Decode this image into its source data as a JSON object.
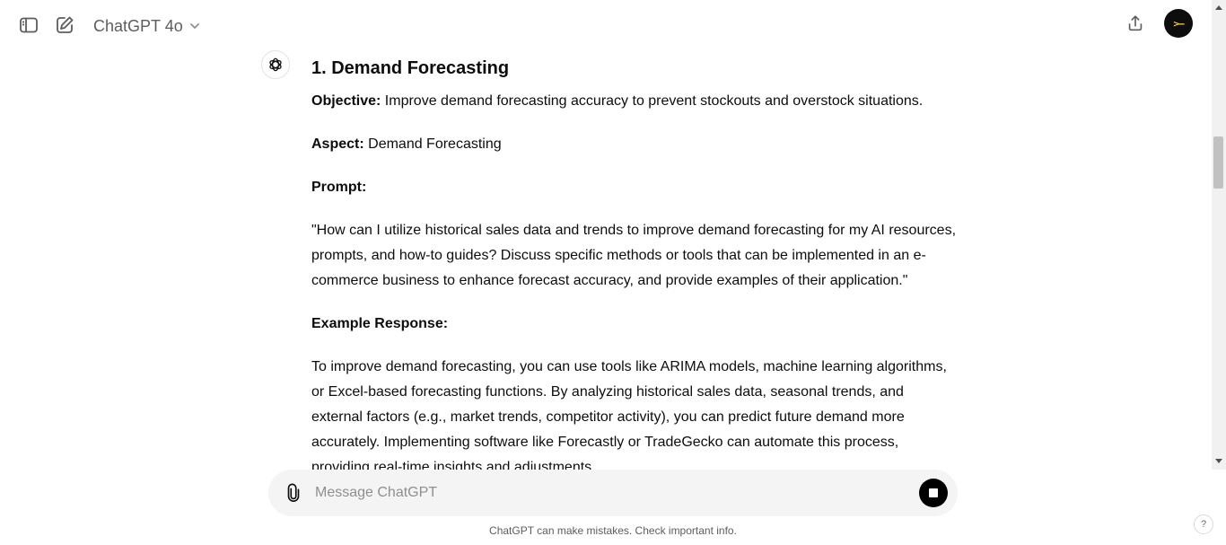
{
  "header": {
    "model_label": "ChatGPT 4o",
    "icons": {
      "sidebar": "sidebar-toggle-icon",
      "new_chat": "new-chat-icon",
      "dropdown": "chevron-down-icon",
      "share": "share-icon"
    },
    "avatar_text": ">–"
  },
  "message": {
    "heading": "1. Demand Forecasting",
    "objective_label": "Objective:",
    "objective_text": " Improve demand forecasting accuracy to prevent stockouts and overstock situations.",
    "aspect_label": "Aspect:",
    "aspect_text": " Demand Forecasting",
    "prompt_label": "Prompt:",
    "prompt_text": "\"How can I utilize historical sales data and trends to improve demand forecasting for my AI resources, prompts, and how-to guides? Discuss specific methods or tools that can be implemented in an e-commerce business to enhance forecast accuracy, and provide examples of their application.\"",
    "example_label": "Example Response:",
    "example_text": "To improve demand forecasting, you can use tools like ARIMA models, machine learning algorithms, or Excel-based forecasting functions. By analyzing historical sales data, seasonal trends, and external factors (e.g., market trends, competitor activity), you can predict future demand more accurately. Implementing software like Forecastly or TradeGecko can automate this process, providing real-time insights and adjustments."
  },
  "composer": {
    "placeholder": "Message ChatGPT"
  },
  "footer": {
    "disclaimer": "ChatGPT can make mistakes. Check important info.",
    "help_label": "?"
  },
  "colors": {
    "accent": "#0d0d0d",
    "composer_bg": "#f4f4f4",
    "muted_text": "#5d5d5d",
    "avatar_text": "#f2c94c"
  }
}
